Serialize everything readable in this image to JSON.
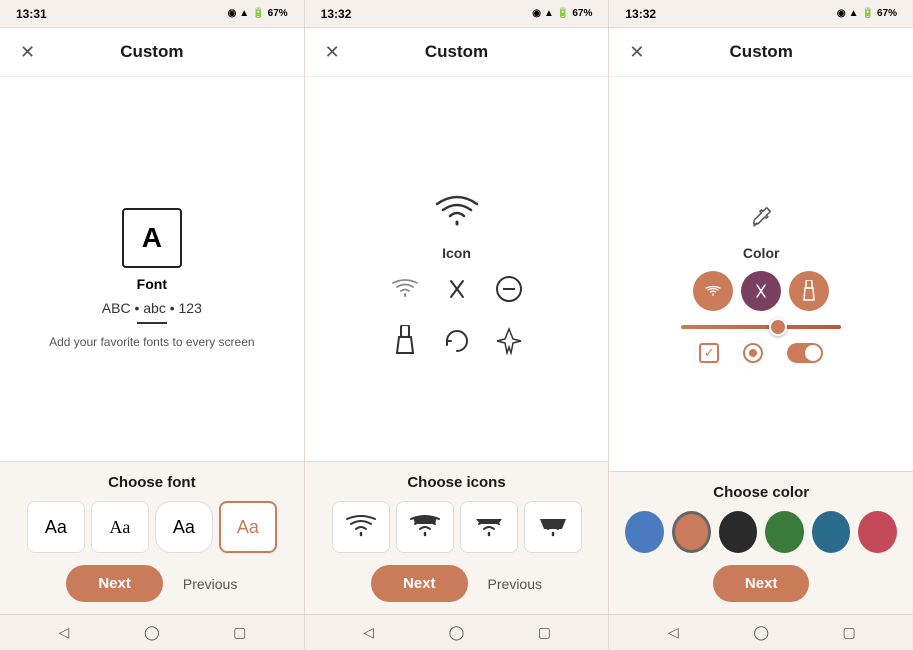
{
  "statusBar": {
    "segments": [
      {
        "time": "13:31",
        "battery": "67%"
      },
      {
        "time": "13:32",
        "battery": "67%"
      },
      {
        "time": "13:32",
        "battery": "67%"
      }
    ]
  },
  "panels": [
    {
      "id": "font-panel",
      "title": "Custom",
      "closeLabel": "✕",
      "preview": {
        "iconChar": "A",
        "label": "Font",
        "sample": "ABC • abc • 123",
        "description": "Add your favorite fonts to every screen"
      },
      "bottom": {
        "sectionTitle": "Choose font",
        "options": [
          {
            "label": "Aa",
            "style": "default",
            "selected": false
          },
          {
            "label": "Aa",
            "style": "serif",
            "selected": false
          },
          {
            "label": "Aa",
            "style": "rounded",
            "selected": false
          },
          {
            "label": "Aa",
            "style": "selected",
            "selected": true
          }
        ]
      },
      "actions": {
        "nextLabel": "Next",
        "previousLabel": "Previous"
      }
    },
    {
      "id": "icon-panel",
      "title": "Custom",
      "closeLabel": "✕",
      "preview": {
        "topIconLabel": "Icon",
        "icons": [
          "wifi",
          "bluetooth",
          "minus-circle",
          "flashlight",
          "rotate",
          "airplane"
        ]
      },
      "bottom": {
        "sectionTitle": "Choose icons",
        "options": [
          "icon-wifi-full",
          "icon-wifi-3",
          "icon-wifi-2",
          "icon-wifi-1"
        ]
      },
      "actions": {
        "nextLabel": "Next",
        "previousLabel": "Previous"
      }
    },
    {
      "id": "color-panel",
      "title": "Custom",
      "closeLabel": "✕",
      "preview": {
        "label": "Color",
        "circles": [
          {
            "color": "#c97b5a",
            "icon": "wifi"
          },
          {
            "color": "#8b4a6b",
            "icon": "bluetooth"
          },
          {
            "color": "#c97b5a",
            "icon": "flashlight"
          }
        ],
        "sliderValue": 55
      },
      "bottom": {
        "sectionTitle": "Choose color",
        "colors": [
          {
            "hex": "#4a7abf",
            "selected": false
          },
          {
            "hex": "#c97b5a",
            "selected": true
          },
          {
            "hex": "#2a2a2a",
            "selected": false
          },
          {
            "hex": "#3a7a3a",
            "selected": false
          },
          {
            "hex": "#2a6a8a",
            "selected": false
          },
          {
            "hex": "#c44a5a",
            "selected": false
          }
        ]
      },
      "actions": {
        "nextLabel": "Next"
      }
    }
  ],
  "navBar": {
    "backIcon": "◁",
    "homeIcon": "◯",
    "recentIcon": "▢"
  }
}
